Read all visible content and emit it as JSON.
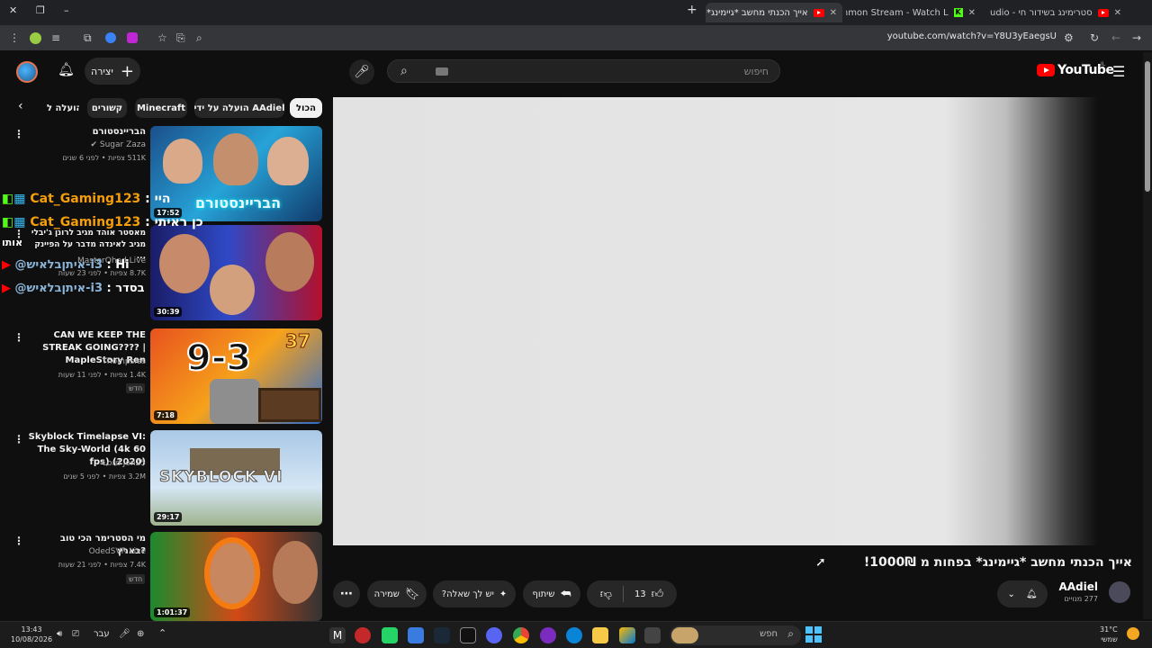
{
  "browser": {
    "tabs": [
      {
        "title": "סטרימינג בשידור חי - be Studio",
        "active": false
      },
      {
        "title": "sagimonmon Stream - Watch L",
        "active": false
      },
      {
        "title": "אייך הכנתי מחשב *גיימינג*",
        "active": true
      }
    ],
    "url": "youtube.com/watch?v=Y8U3yEaegsU"
  },
  "header": {
    "logo_text": "YouTube",
    "logo_region": "IL",
    "search_placeholder": "חיפוש",
    "create_label": "יצירה"
  },
  "chips": [
    "הכול",
    "AAdiel הועלה על ידי",
    "Minecraft",
    "קשורים",
    "הועלה ל"
  ],
  "videos": [
    {
      "title": "הבריינסטורם",
      "channel": "Sugar Zaza",
      "verified": true,
      "meta": "511K צפיות • לפני 6 שנים",
      "duration": "17:52",
      "thumb_text": "הבריינסטורם"
    },
    {
      "title": "מאסטר אוהד מגיב לרונן ג'יבלי מגיב לאינדה מדבר על הפיינק ...",
      "channel": "MasterOhad Live",
      "meta": "8.7K צפיות • לפני 23 שעות",
      "duration": "30:39"
    },
    {
      "title": "CAN WE KEEP THE STREAK GOING???? | MapleStory Ren",
      "channel": "Thompsies",
      "meta": "1.4K צפיות • לפני 11 שעות",
      "badge": "חדש",
      "duration": "7:18",
      "thumb_text": "9-3",
      "thumb_num": "37"
    },
    {
      "title": "Skyblock Timelapse VI: The Sky-World (4k 60 fps) (2020)",
      "channel": "Lord Jon25",
      "meta": "3.2M צפיות • לפני 5 שנים",
      "duration": "29:17",
      "thumb_text": "SKYBLOCK VI"
    },
    {
      "title": "מי הסטרימר הכי טוב בארץ?",
      "channel": "OdedSVR Live",
      "meta": "7.4K צפיות • לפני 21 שעות",
      "badge": "חדש",
      "duration": "1:01:37"
    }
  ],
  "chat_overlay": [
    {
      "user": "Cat_Gaming123",
      "msg": "היי"
    },
    {
      "user": "Cat_Gaming123",
      "msg": "כן ראיתי"
    },
    {
      "side_label": "אותו"
    },
    {
      "user": "@איתןבלאיש-i3",
      "msg": "Hi"
    },
    {
      "user": "@איתןבלאיש-i3",
      "msg": "בסדר"
    }
  ],
  "video": {
    "title": "אייך הכנתי מחשב *גיימינג* בפחות מ 1000₪!",
    "channel": "AAdiel",
    "subscribers": "277 מנויים",
    "likes": "13",
    "share_label": "שיתוף",
    "ask_label": "יש לך שאלה?",
    "save_label": "שמירה"
  },
  "taskbar": {
    "time": "13:43",
    "date": "10/08/2026",
    "lang": "עבר",
    "weather_temp": "31°C",
    "weather_desc": "שמשי",
    "search_placeholder": "חפש"
  }
}
